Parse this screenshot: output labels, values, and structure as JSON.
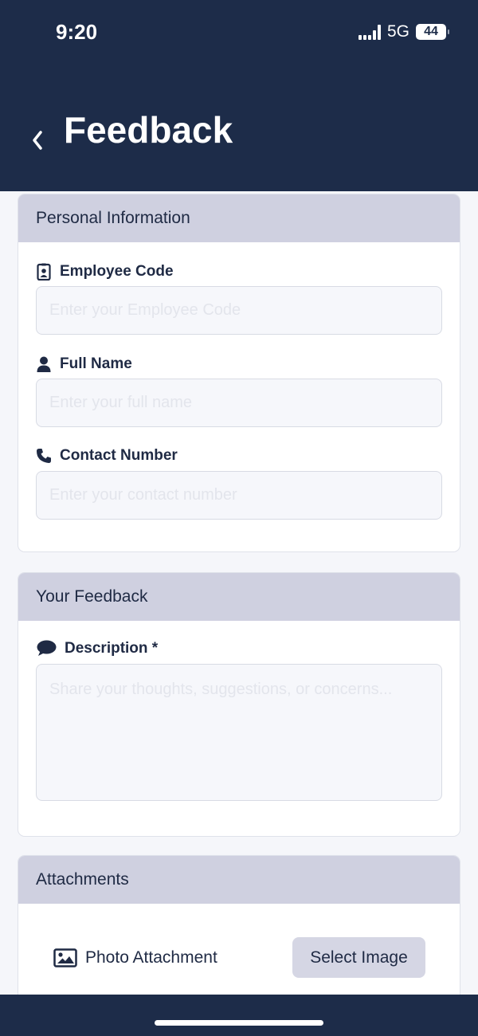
{
  "status_bar": {
    "time": "9:20",
    "network": "5G",
    "battery": "44"
  },
  "header": {
    "title": "Feedback",
    "back_icon": "chevron-left-icon"
  },
  "personal_info": {
    "title": "Personal Information",
    "employee_code": {
      "label": "Employee Code",
      "icon": "id-badge-icon",
      "placeholder": "Enter your Employee Code",
      "value": ""
    },
    "full_name": {
      "label": "Full Name",
      "icon": "user-icon",
      "placeholder": "Enter your full name",
      "value": ""
    },
    "contact_number": {
      "label": "Contact Number",
      "icon": "phone-icon",
      "placeholder": "Enter your contact number",
      "value": ""
    }
  },
  "feedback": {
    "title": "Your Feedback",
    "description": {
      "label": "Description *",
      "icon": "comment-icon",
      "placeholder": "Share your thoughts, suggestions, or concerns...",
      "value": ""
    }
  },
  "attachments": {
    "title": "Attachments",
    "photo_label": "Photo Attachment",
    "photo_icon": "image-icon",
    "select_button": "Select Image"
  },
  "colors": {
    "header_bg": "#1d2c49",
    "section_header_bg": "#cfd0e0",
    "button_bg": "#d5d6e4",
    "page_bg": "#f5f6fa"
  }
}
